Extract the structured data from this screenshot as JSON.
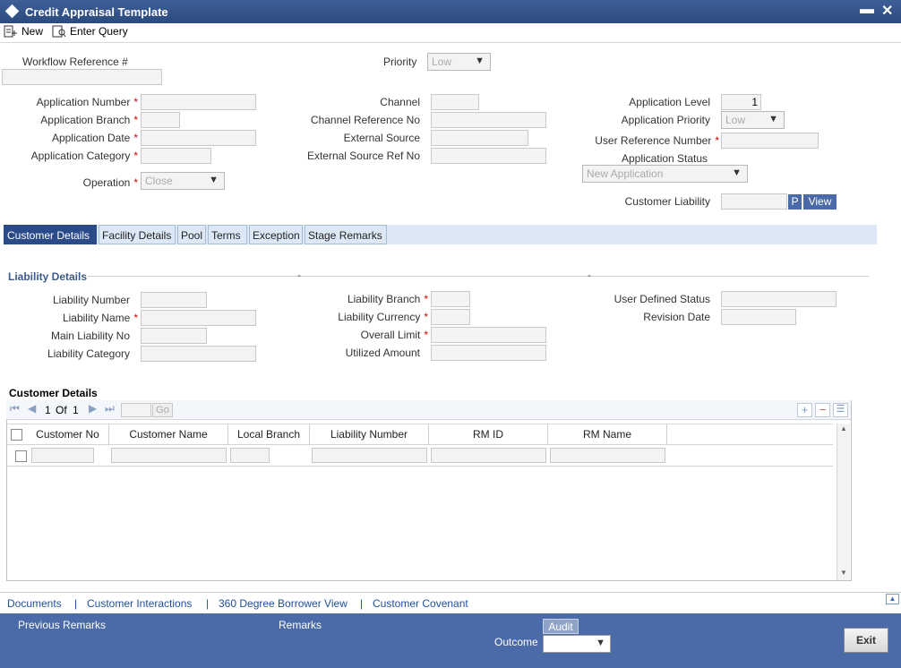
{
  "window": {
    "title": "Credit Appraisal Template",
    "minimize": "▬",
    "close": "✕"
  },
  "toolbar": {
    "new_label": "New",
    "enter_query_label": "Enter Query"
  },
  "header": {
    "workflow_ref_label": "Workflow Reference #",
    "workflow_ref_value": "",
    "priority_label": "Priority",
    "priority_value": "Low"
  },
  "form": {
    "app_number_label": "Application Number",
    "app_branch_label": "Application Branch",
    "app_date_label": "Application Date",
    "app_category_label": "Application Category",
    "operation_label": "Operation",
    "operation_value": "Close",
    "channel_label": "Channel",
    "channel_ref_label": "Channel Reference No",
    "external_source_label": "External Source",
    "external_source_ref_label": "External Source Ref No",
    "app_level_label": "Application Level",
    "app_level_value": "1",
    "app_priority_label": "Application Priority",
    "app_priority_value": "Low",
    "user_ref_label": "User Reference Number",
    "app_status_label": "Application Status",
    "app_status_value": "New Application",
    "customer_liability_label": "Customer Liability",
    "p_button": "P",
    "view_button": "View",
    "required_mark": "*"
  },
  "tabs": [
    "Customer Details",
    "Facility Details",
    "Pool",
    "Terms",
    "Exception",
    "Stage Remarks"
  ],
  "liability": {
    "section_title": "Liability Details",
    "dash": "-",
    "liability_number_label": "Liability Number",
    "liability_name_label": "Liability Name",
    "main_liability_label": "Main Liability No",
    "liability_category_label": "Liability Category",
    "liability_branch_label": "Liability Branch",
    "liability_currency_label": "Liability Currency",
    "overall_limit_label": "Overall Limit",
    "utilized_amount_label": "Utilized Amount",
    "user_defined_status_label": "User Defined Status",
    "revision_date_label": "Revision Date"
  },
  "customer_grid": {
    "title": "Customer Details",
    "page_current": "1",
    "page_of": "Of",
    "page_total": "1",
    "go_label": "Go",
    "columns": [
      "Customer No",
      "Customer Name",
      "Local Branch",
      "Liability Number",
      "RM ID",
      "RM Name"
    ]
  },
  "footer_links": [
    "Documents",
    "Customer Interactions",
    "360 Degree Borrower View",
    "Customer Covenant"
  ],
  "footer_separator": "|",
  "bottom": {
    "previous_remarks_label": "Previous Remarks",
    "remarks_label": "Remarks",
    "audit_label": "Audit",
    "outcome_label": "Outcome",
    "exit_label": "Exit"
  }
}
